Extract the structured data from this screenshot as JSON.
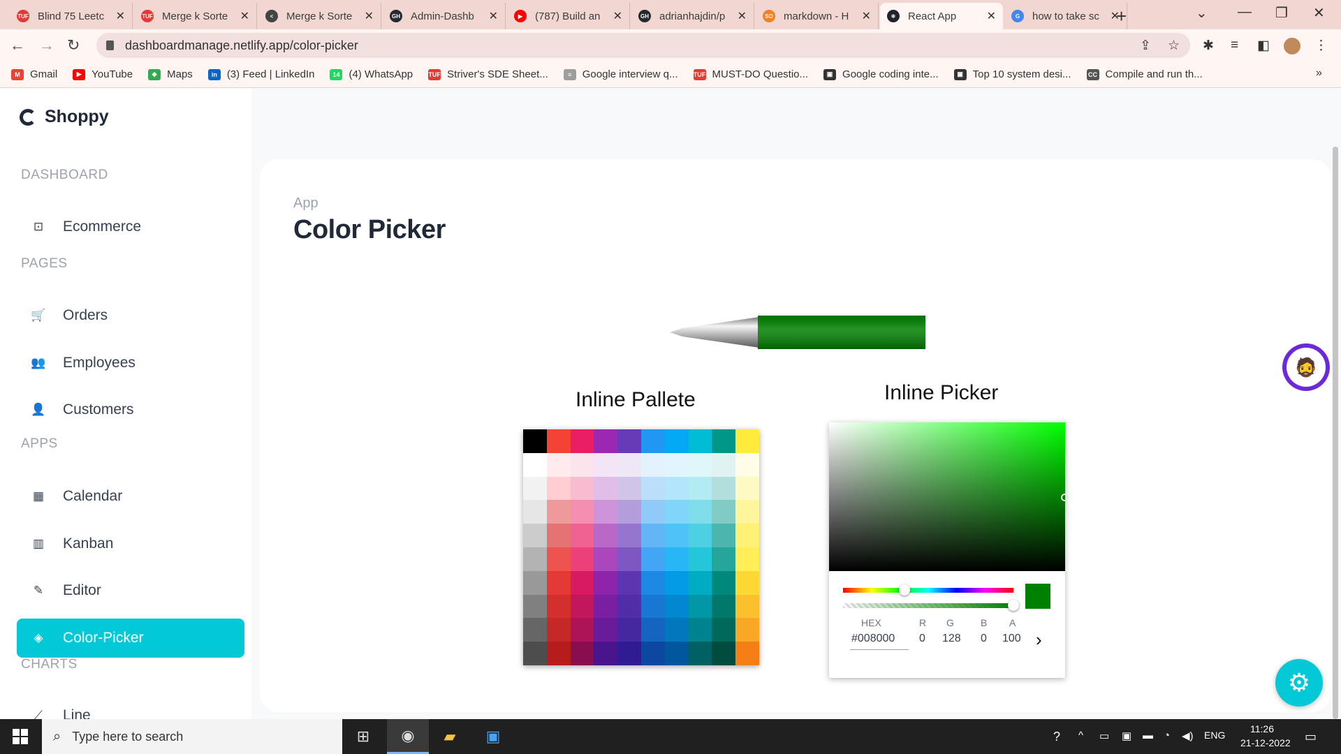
{
  "browser": {
    "tabs": [
      {
        "title": "Blind 75 Leetc",
        "fav_color": "#e53935",
        "fav_text": "TUF"
      },
      {
        "title": "Merge k Sorte",
        "fav_color": "#e53935",
        "fav_text": "TUF"
      },
      {
        "title": "Merge k Sorte",
        "fav_color": "#444444",
        "fav_text": "<"
      },
      {
        "title": "Admin-Dashb",
        "fav_color": "#24292e",
        "fav_text": "GH"
      },
      {
        "title": "(787) Build an",
        "fav_color": "#ff0000",
        "fav_text": "▶"
      },
      {
        "title": "adrianhajdin/p",
        "fav_color": "#24292e",
        "fav_text": "GH"
      },
      {
        "title": "markdown - H",
        "fav_color": "#f48024",
        "fav_text": "SO"
      },
      {
        "title": "React App",
        "fav_color": "#20232a",
        "fav_text": "⚛",
        "active": true
      },
      {
        "title": "how to take sc",
        "fav_color": "#4285f4",
        "fav_text": "G"
      }
    ],
    "url": "dashboardmanage.netlify.app/color-picker",
    "bookmarks": [
      {
        "label": "Gmail",
        "color": "#ea4335",
        "mark": "M"
      },
      {
        "label": "YouTube",
        "color": "#ff0000",
        "mark": "▶"
      },
      {
        "label": "Maps",
        "color": "#34a853",
        "mark": "◆"
      },
      {
        "label": "(3) Feed | LinkedIn",
        "color": "#0a66c2",
        "mark": "in"
      },
      {
        "label": "(4) WhatsApp",
        "color": "#25d366",
        "mark": "14"
      },
      {
        "label": "Striver's SDE Sheet...",
        "color": "#e53935",
        "mark": "TUF"
      },
      {
        "label": "Google interview q...",
        "color": "#9e9e9e",
        "mark": "≡"
      },
      {
        "label": "MUST-DO Questio...",
        "color": "#e53935",
        "mark": "TUF"
      },
      {
        "label": "Google coding inte...",
        "color": "#333333",
        "mark": "▣"
      },
      {
        "label": "Top 10 system desi...",
        "color": "#333333",
        "mark": "▣"
      },
      {
        "label": "Compile and run th...",
        "color": "#555555",
        "mark": "CC"
      }
    ]
  },
  "app": {
    "brand": "Shoppy",
    "sidebar": {
      "sections": [
        {
          "title": "DASHBOARD",
          "items": [
            {
              "label": "Ecommerce",
              "icon": "shopping-bag-icon",
              "glyph": "⊡"
            }
          ]
        },
        {
          "title": "PAGES",
          "items": [
            {
              "label": "Orders",
              "icon": "cart-icon",
              "glyph": "🛒"
            },
            {
              "label": "Employees",
              "icon": "employees-icon",
              "glyph": "👥"
            },
            {
              "label": "Customers",
              "icon": "customers-icon",
              "glyph": "👤"
            }
          ]
        },
        {
          "title": "APPS",
          "items": [
            {
              "label": "Calendar",
              "icon": "calendar-icon",
              "glyph": "▦"
            },
            {
              "label": "Kanban",
              "icon": "kanban-icon",
              "glyph": "▥"
            },
            {
              "label": "Editor",
              "icon": "edit-icon",
              "glyph": "✎"
            },
            {
              "label": "Color-Picker",
              "icon": "color-picker-icon",
              "glyph": "◈",
              "active": true
            }
          ]
        },
        {
          "title": "CHARTS",
          "items": [
            {
              "label": "Line",
              "icon": "line-chart-icon",
              "glyph": "⟋"
            }
          ]
        }
      ]
    },
    "main": {
      "breadcrumb": "App",
      "title": "Color Picker",
      "pen_color": "#008000",
      "palette_title": "Inline Pallete",
      "picker_title": "Inline Picker",
      "palette_colors": [
        [
          "#000000",
          "#f44336",
          "#e91e63",
          "#9c27b0",
          "#673ab7",
          "#2196f3",
          "#03a9f4",
          "#00bcd4",
          "#009688",
          "#ffeb3b"
        ],
        [
          "#ffffff",
          "#ffebee",
          "#fce4ec",
          "#f3e5f5",
          "#ede7f6",
          "#e3f2fd",
          "#e1f5fe",
          "#e0f7fa",
          "#e0f2f1",
          "#fffde7"
        ],
        [
          "#f2f2f2",
          "#ffcdd2",
          "#f8bbd0",
          "#e1bee7",
          "#d1c4e9",
          "#bbdefb",
          "#b3e5fc",
          "#b2ebf2",
          "#b2dfdb",
          "#fff9c4"
        ],
        [
          "#e6e6e6",
          "#ef9a9a",
          "#f48fb1",
          "#ce93d8",
          "#b39ddb",
          "#90caf9",
          "#81d4fa",
          "#80deea",
          "#80cbc4",
          "#fff59d"
        ],
        [
          "#cccccc",
          "#e57373",
          "#f06292",
          "#ba68c8",
          "#9575cd",
          "#64b5f6",
          "#4fc3f7",
          "#4dd0e1",
          "#4db6ac",
          "#fff176"
        ],
        [
          "#b3b3b3",
          "#ef5350",
          "#ec407a",
          "#ab47bc",
          "#7e57c2",
          "#42a5f5",
          "#29b6f6",
          "#26c6da",
          "#26a69a",
          "#ffee58"
        ],
        [
          "#999999",
          "#e53935",
          "#d81b60",
          "#8e24aa",
          "#5e35b1",
          "#1e88e5",
          "#039be5",
          "#00acc1",
          "#00897b",
          "#fdd835"
        ],
        [
          "#808080",
          "#d32f2f",
          "#c2185b",
          "#7b1fa2",
          "#512da8",
          "#1976d2",
          "#0288d1",
          "#0097a7",
          "#00796b",
          "#fbc02d"
        ],
        [
          "#666666",
          "#c62828",
          "#ad1457",
          "#6a1b9a",
          "#4527a0",
          "#1565c0",
          "#0277bd",
          "#00838f",
          "#00695c",
          "#f9a825"
        ],
        [
          "#4d4d4d",
          "#b71c1c",
          "#880e4f",
          "#4a148c",
          "#311b92",
          "#0d47a1",
          "#01579b",
          "#006064",
          "#004d40",
          "#f57f17"
        ]
      ],
      "picker": {
        "hex_label": "HEX",
        "hex": "#008000",
        "r_label": "R",
        "r": "0",
        "g_label": "G",
        "g": "128",
        "b_label": "B",
        "b": "0",
        "a_label": "A",
        "a": "100"
      }
    }
  },
  "taskbar": {
    "search_placeholder": "Type here to search",
    "lang": "ENG",
    "time": "11:26",
    "date": "21-12-2022"
  }
}
